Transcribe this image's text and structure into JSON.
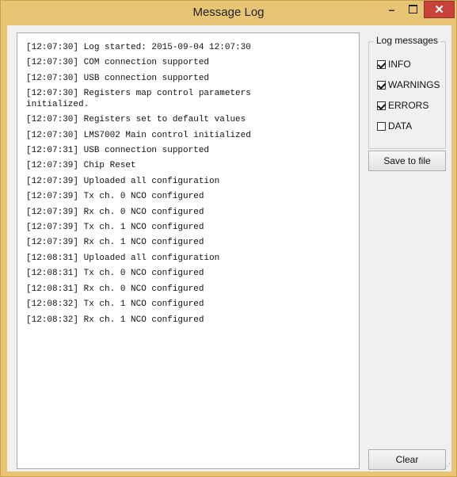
{
  "window": {
    "title": "Message Log",
    "minimize_glyph": "–",
    "close_glyph": "✕"
  },
  "log": {
    "lines": [
      "[12:07:30] Log started: 2015-09-04 12:07:30",
      "[12:07:30] COM connection supported",
      "[12:07:30] USB connection supported",
      "[12:07:30] Registers map control parameters\ninitialized.",
      "[12:07:30] Registers set to default values",
      "[12:07:30] LMS7002 Main control initialized",
      "[12:07:31] USB connection supported",
      "[12:07:39] Chip Reset",
      "[12:07:39] Uploaded all configuration",
      "[12:07:39] Tx ch. 0 NCO configured",
      "[12:07:39] Rx ch. 0 NCO configured",
      "[12:07:39] Tx ch. 1 NCO configured",
      "[12:07:39] Rx ch. 1 NCO configured",
      "[12:08:31] Uploaded all configuration",
      "[12:08:31] Tx ch. 0 NCO configured",
      "[12:08:31] Rx ch. 0 NCO configured",
      "[12:08:32] Tx ch. 1 NCO configured",
      "[12:08:32] Rx ch. 1 NCO configured"
    ]
  },
  "filters": {
    "title": "Log messages",
    "items": [
      {
        "label": "INFO",
        "checked": true
      },
      {
        "label": "WARNINGS",
        "checked": true
      },
      {
        "label": "ERRORS",
        "checked": true
      },
      {
        "label": "DATA",
        "checked": false
      }
    ]
  },
  "buttons": {
    "save": "Save to file",
    "clear": "Clear"
  }
}
